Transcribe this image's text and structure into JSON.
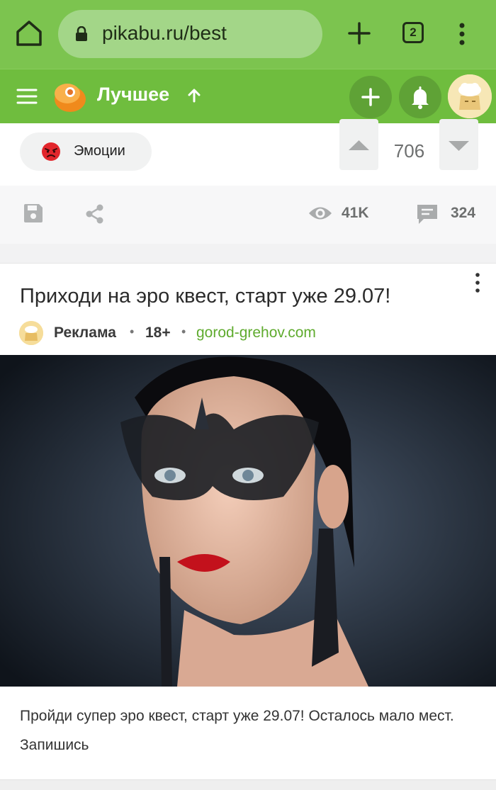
{
  "browser": {
    "url": "pikabu.ru/best",
    "tab_count": "2"
  },
  "header": {
    "section_title": "Лучшее"
  },
  "prev_post": {
    "tag_label": "Эмоции",
    "rating": "706",
    "views": "41K",
    "comments": "324"
  },
  "ad_post": {
    "title": "Приходи на эро квест, старт уже 29.07!",
    "author": "Реклама",
    "age_rating": "18+",
    "site": "gorod-grehov.com",
    "separator": "•",
    "text": "Пройди супер эро квест, старт уже 29.07! Осталось мало мест. Запишись"
  },
  "colors": {
    "browser_green": "#7cc44f",
    "header_green": "#6fbd3e",
    "link_green": "#5fab2e"
  }
}
